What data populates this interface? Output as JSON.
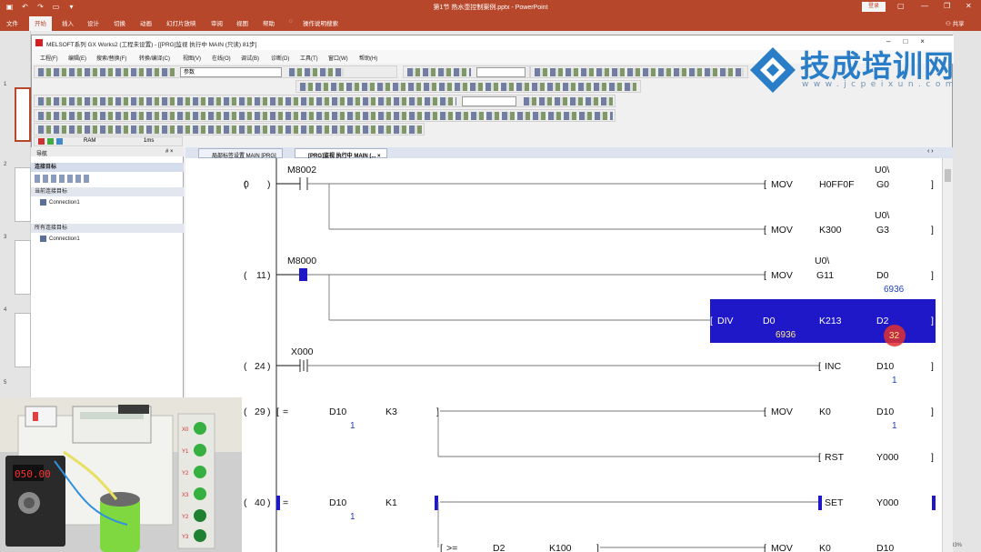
{
  "ppt": {
    "doc_title": "第1节 热水壶控制案例.pptx  -  PowerPoint",
    "login": "登录",
    "tabs": [
      "文件",
      "开始",
      "插入",
      "设计",
      "切换",
      "动画",
      "幻灯片放映",
      "审阅",
      "视图",
      "帮助"
    ],
    "tell_me": "操作说明搜索",
    "share": "共享",
    "slide_numbers": [
      "1",
      "2",
      "3",
      "4",
      "5"
    ],
    "zoom": "33%"
  },
  "gx": {
    "title": "MELSOFT系列 GX Works2 (工程未设置) - [[PRG]监视 执行中 MAIN (只读) 81步]",
    "menu": [
      "工程(F)",
      "编辑(E)",
      "搜索/替换(F)",
      "转换/编译(C)",
      "视图(V)",
      "在线(O)",
      "调试(B)",
      "诊断(D)",
      "工具(T)",
      "窗口(W)",
      "帮助(H)"
    ],
    "combo_value": "参数",
    "status_ram": "RAM",
    "status_ms": "1ms"
  },
  "watermark": {
    "name": "技成培训网",
    "url": "www.jcpeixun.com"
  },
  "nav": {
    "title": "导航",
    "pin": "# ×",
    "header": "连接目标",
    "current_section": "当前连接目标",
    "current_item": "Connection1",
    "all_section": "所有连接目标",
    "all_item": "Connection1"
  },
  "editor": {
    "tabs": [
      "局部标签设置 MAIN [PRG]",
      "[PRG]监视 执行中 MAIN (..."
    ],
    "tab_close": "×"
  },
  "ladder": {
    "rungs": [
      {
        "step": "0",
        "contact": "M8002",
        "instrs": [
          {
            "op": "MOV",
            "a": "H0FF0F",
            "b_top": "U0\\",
            "b": "G0"
          },
          {
            "op": "MOV",
            "a": "K300",
            "b_top": "U0\\",
            "b": "G3"
          }
        ]
      },
      {
        "step": "11",
        "contact": "M8000",
        "instrs": [
          {
            "op": "MOV",
            "a_top": "U0\\",
            "a": "G11",
            "b": "D0",
            "b_val": "6936"
          },
          {
            "op": "DIV",
            "s1": "D0",
            "s1_val": "6936",
            "a": "K213",
            "b": "D2",
            "b_val": "32",
            "selected": true
          }
        ]
      },
      {
        "step": "24",
        "contact": "X000",
        "instrs": [
          {
            "op": "INC",
            "b": "D10",
            "b_val": "1"
          }
        ]
      },
      {
        "step": "29",
        "cmp": {
          "op": "=",
          "s1": "D10",
          "s1_val": "1",
          "s2": "K3"
        },
        "instrs": [
          {
            "op": "MOV",
            "a": "K0",
            "b": "D10",
            "b_val": "1"
          },
          {
            "op": "RST",
            "b": "Y000"
          }
        ]
      },
      {
        "step": "40",
        "cmp": {
          "op": "=",
          "s1": "D10",
          "s1_val": "1",
          "s2": "K1"
        },
        "instrs": [
          {
            "op": "SET",
            "b": "Y000"
          },
          {
            "op": "MOV",
            "a": "K0",
            "b": "D10"
          }
        ],
        "cmp2": {
          "op": ">=",
          "s1": "D2",
          "s2": "K100"
        }
      }
    ]
  },
  "video": {
    "display_value": "050.00",
    "panel_labels": [
      "X0",
      "Y1",
      "Y2",
      "X3",
      "Y2",
      "Y3"
    ]
  },
  "colors": {
    "ppt_red": "#b7472a",
    "select_blue": "#1e18c8",
    "value_blue": "#2040c0",
    "cursor_red": "#e03030"
  }
}
